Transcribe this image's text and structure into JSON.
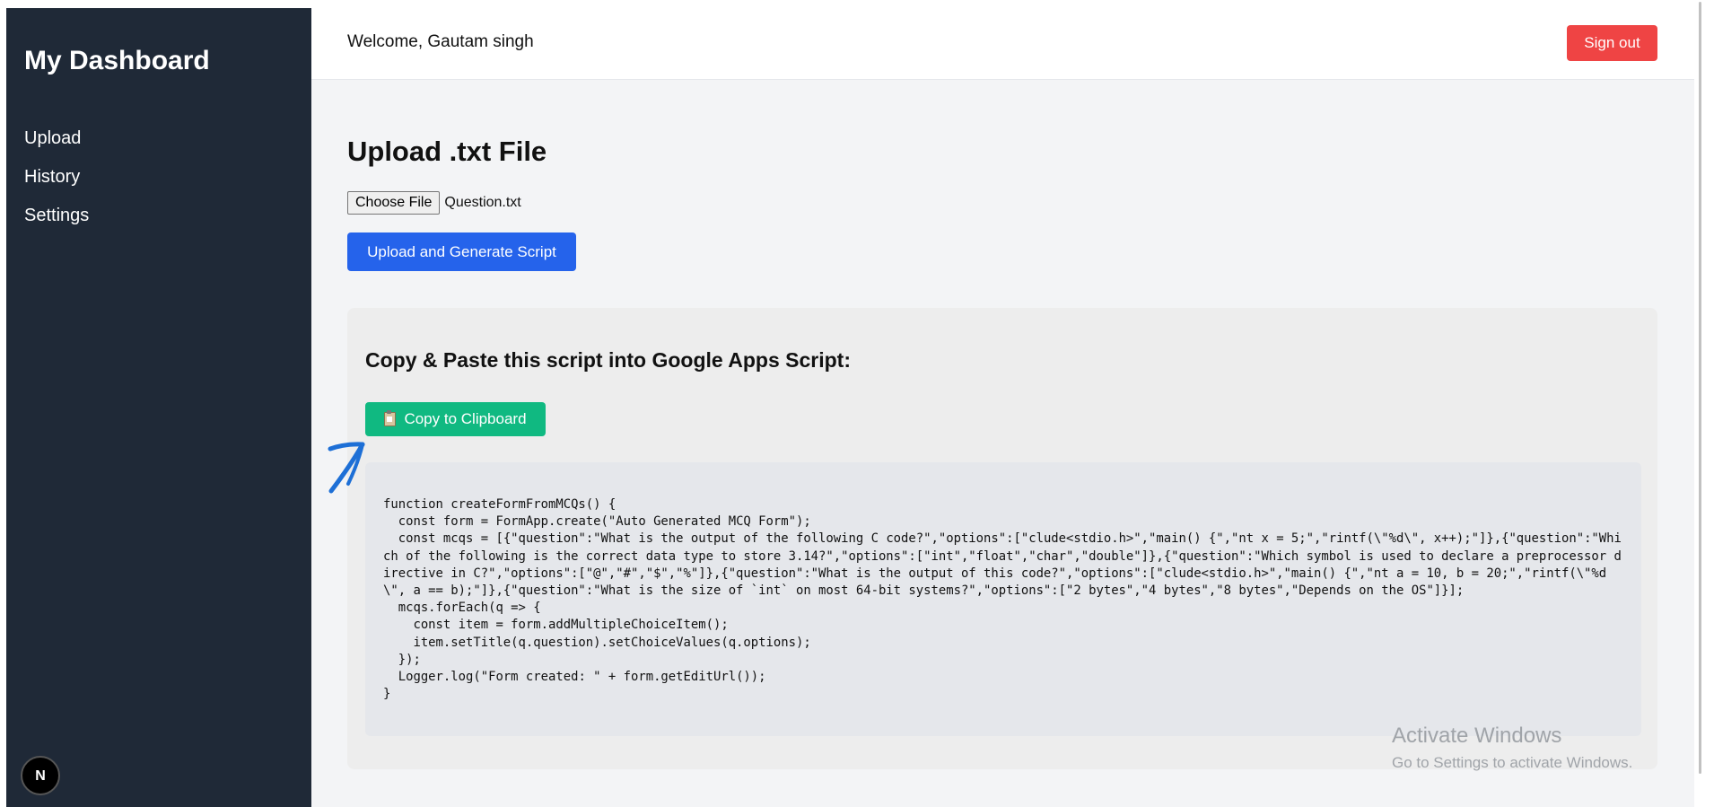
{
  "sidebar": {
    "brand": "My Dashboard",
    "items": [
      {
        "label": "Upload"
      },
      {
        "label": "History"
      },
      {
        "label": "Settings"
      }
    ],
    "badge_letter": "N"
  },
  "header": {
    "welcome": "Welcome, Gautam singh",
    "sign_out_label": "Sign out"
  },
  "main": {
    "title": "Upload .txt File",
    "choose_file_label": "Choose File",
    "file_name": "Question.txt",
    "upload_button_label": "Upload and Generate Script",
    "script_panel": {
      "heading": "Copy & Paste this script into Google Apps Script:",
      "copy_button_label": "Copy to Clipboard",
      "copy_icon": "clipboard-icon",
      "code": "function createFormFromMCQs() {\n  const form = FormApp.create(\"Auto Generated MCQ Form\");\n  const mcqs = [{\"question\":\"What is the output of the following C code?\",\"options\":[\"clude<stdio.h>\",\"main() {\",\"nt x = 5;\",\"rintf(\\\"%d\\\", x++);\"]},{\"question\":\"Which of the following is the correct data type to store 3.14?\",\"options\":[\"int\",\"float\",\"char\",\"double\"]},{\"question\":\"Which symbol is used to declare a preprocessor directive in C?\",\"options\":[\"@\",\"#\",\"$\",\"%\"]},{\"question\":\"What is the output of this code?\",\"options\":[\"clude<stdio.h>\",\"main() {\",\"nt a = 10, b = 20;\",\"rintf(\\\"%d\\\", a == b);\"]},{\"question\":\"What is the size of `int` on most 64-bit systems?\",\"options\":[\"2 bytes\",\"4 bytes\",\"8 bytes\",\"Depends on the OS\"]}];\n  mcqs.forEach(q => {\n    const item = form.addMultipleChoiceItem();\n    item.setTitle(q.question).setChoiceValues(q.options);\n  });\n  Logger.log(\"Form created: \" + form.getEditUrl());\n}"
    }
  },
  "watermark": {
    "title": "Activate Windows",
    "subtitle": "Go to Settings to activate Windows."
  },
  "colors": {
    "sidebar_bg": "#1f2937",
    "sign_out": "#ef4444",
    "upload_button": "#2563eb",
    "copy_button": "#10b981",
    "annotation_arrow": "#1d6fd6"
  }
}
